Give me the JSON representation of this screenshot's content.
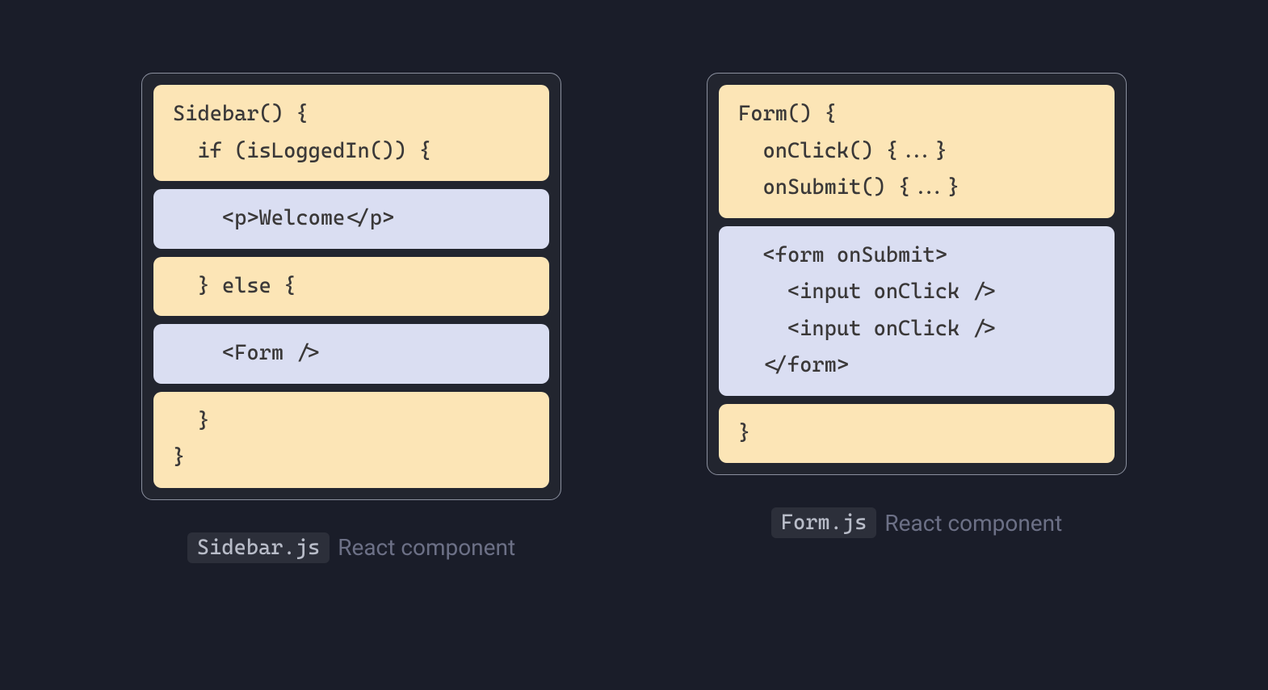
{
  "colors": {
    "background": "#1a1d29",
    "panelBg": "#22252f",
    "panelBorder": "#8a8f9e",
    "yellowBlock": "#fce5b6",
    "purpleBlock": "#dadef2",
    "codeText": "#3a3838",
    "captionText": "#6c7086",
    "filenameBg": "#2c2f3a",
    "filenameText": "#b8bcc8"
  },
  "left": {
    "filename": "Sidebar.js",
    "captionSuffix": "React component",
    "blocks": [
      {
        "kind": "yellow",
        "lines": [
          "Sidebar() {",
          "  if (isLoggedIn()) {"
        ]
      },
      {
        "kind": "purple",
        "lines": [
          "    <p>Welcome</p>"
        ]
      },
      {
        "kind": "yellow",
        "lines": [
          "  } else {"
        ]
      },
      {
        "kind": "purple",
        "lines": [
          "    <Form />"
        ]
      },
      {
        "kind": "yellow",
        "lines": [
          "  }",
          "}"
        ]
      }
    ]
  },
  "right": {
    "filename": "Form.js",
    "captionSuffix": "React component",
    "blocks": [
      {
        "kind": "yellow",
        "lines": [
          "Form() {",
          "  onClick() {...}",
          "  onSubmit() {...}"
        ]
      },
      {
        "kind": "purple",
        "lines": [
          "  <form onSubmit>",
          "    <input onClick />",
          "    <input onClick />",
          "  </form>"
        ]
      },
      {
        "kind": "yellow",
        "lines": [
          "}"
        ]
      }
    ]
  }
}
